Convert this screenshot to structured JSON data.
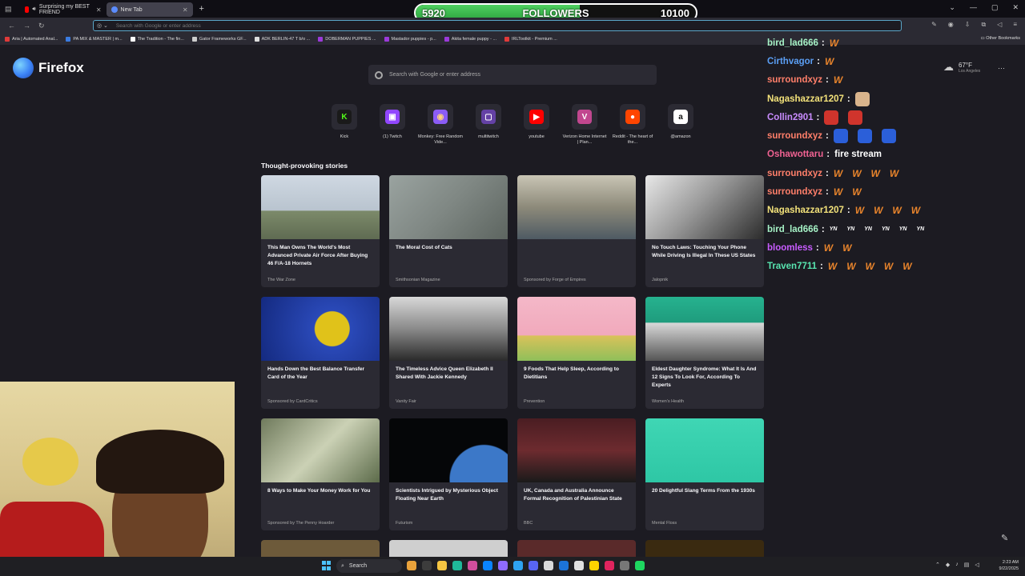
{
  "tabs": [
    {
      "label": "Surprising my BEST FRIEND",
      "active": false
    },
    {
      "label": "New Tab",
      "active": true
    }
  ],
  "followers_goal": {
    "current": "5920",
    "label": "FOLLOWERS",
    "target": "10100",
    "progress": 0.586
  },
  "urlbar": {
    "placeholder": "Search with Google or enter address"
  },
  "bookmarks": [
    "Aria | Automated Anal...",
    "PA MIX & MASTER | m...",
    "The Tradition - The fin...",
    "Gator Frameworks GF...",
    "ADK BERLIN-47 T b/o ...",
    "DOBERMAN PUPPIES ...",
    "Mastador puppies - p...",
    "Akita female puppy - ...",
    "IRLToolkit - Premium ..."
  ],
  "other_bookmarks": "Other Bookmarks",
  "brand": {
    "name": "Firefox"
  },
  "search": {
    "placeholder": "Search with Google or enter address"
  },
  "weather": {
    "temp": "67°F",
    "city": "Los Angeles"
  },
  "shortcuts": [
    {
      "label": "Kick",
      "icon": "kick-icon",
      "bg": "#1a1a1a",
      "fg": "#53fc18",
      "glyph": "K"
    },
    {
      "label": "(1) Twitch",
      "icon": "twitch-icon",
      "bg": "#9146ff",
      "fg": "#ffffff",
      "glyph": "▣"
    },
    {
      "label": "Monkey: Free Random Vide...",
      "icon": "monkey-icon",
      "bg": "#8b5cf6",
      "fg": "#ffd27a",
      "glyph": "◉"
    },
    {
      "label": "multitwitch",
      "icon": "multitwitch-icon",
      "bg": "#6441a5",
      "fg": "#ffffff",
      "glyph": "▢"
    },
    {
      "label": "youtube",
      "icon": "youtube-icon",
      "bg": "#ff0000",
      "fg": "#ffffff",
      "glyph": "▶"
    },
    {
      "label": "Verizon Home Internet | Plan...",
      "icon": "verizon-icon",
      "bg": "#c1478f",
      "fg": "#ffffff",
      "glyph": "V"
    },
    {
      "label": "Reddit - The heart of the...",
      "icon": "reddit-icon",
      "bg": "#ff4500",
      "fg": "#ffffff",
      "glyph": "●"
    },
    {
      "label": "@amazon",
      "icon": "amazon-icon",
      "bg": "#ffffff",
      "fg": "#111111",
      "glyph": "a"
    }
  ],
  "stories_title": "Thought-provoking stories",
  "stories": [
    {
      "title": "This Man Owns The World's Most Advanced Private Air Force After Buying 46 F/A-18 Hornets",
      "source": "The War Zone",
      "img": "linear-gradient(180deg,#cfd8e2 0%,#b9c4cf 55%,#7c8a6a 56%,#5f6b52 100%)"
    },
    {
      "title": "The Moral Cost of Cats",
      "source": "Smithsonian Magazine",
      "img": "linear-gradient(135deg,#9aa3a0 0%,#7f8783 50%,#5d6560 100%)"
    },
    {
      "title": "",
      "source": "Sponsored by Forge of Empires",
      "img": "linear-gradient(180deg,#c9c5b5 0%,#8d8a7a 50%,#4e5a63 100%)"
    },
    {
      "title": "No Touch Laws: Touching Your Phone While Driving Is Illegal In These US States",
      "source": "Jalopnik",
      "img": "linear-gradient(135deg,#e8e8e8 0%,#9a9a9a 45%,#2b2b2b 100%)"
    },
    {
      "title": "Hands Down the Best Balance Transfer Card of the Year",
      "source": "Sponsored by CardCritics",
      "img": "radial-gradient(circle at 60% 50%,#e0c21a 0 22%,#2a49b8 23%,#142a80 100%)"
    },
    {
      "title": "The Timeless Advice Queen Elizabeth II Shared With Jackie Kennedy",
      "source": "Vanity Fair",
      "img": "linear-gradient(180deg,#d8d8d8 0%,#8a8a8a 50%,#2a2a2a 100%)"
    },
    {
      "title": "9 Foods That Help Sleep, According to Dietitians",
      "source": "Prevention",
      "img": "linear-gradient(180deg,#f4b8c8 0%,#f1a9bc 60%,#d9c25a 61%,#8fbf5a 100%)"
    },
    {
      "title": "Eldest Daughter Syndrome: What It Is And 12 Signs To Look For, According To Experts",
      "source": "Women's Health",
      "img": "linear-gradient(180deg,#26b28f 0%,#1f9c7d 40%,#d8d8d8 41%,#555 100%)"
    },
    {
      "title": "8 Ways to Make Your Money Work for You",
      "source": "Sponsored by The Penny Hoarder",
      "img": "linear-gradient(135deg,#6f7a5c 0%,#cbd1b5 50%,#5c6b4a 100%)"
    },
    {
      "title": "Scientists Intrigued by Mysterious Object Floating Near Earth",
      "source": "Futurism",
      "img": "radial-gradient(circle at 80% 95%,#3c78c8 0 30%,#050608 31%,#050608 100%)"
    },
    {
      "title": "UK, Canada and Australia Announce Formal Recognition of Palestinian State",
      "source": "BBC",
      "img": "linear-gradient(180deg,#4a1d22 0%,#6d2b2f 50%,#1a1a1a 100%)"
    },
    {
      "title": "20 Delightful Slang Terms From the 1930s",
      "source": "Mental Floss",
      "img": "linear-gradient(180deg,#3fd6b4 0%,#2ec7a5 100%)"
    }
  ],
  "partial_rows": [
    "#6d5a3a",
    "#cfcfcf",
    "#5a2a2a",
    "#3a2a10"
  ],
  "chat": [
    {
      "user": "bird_lad666",
      "color": "#a6f2c6",
      "text": "",
      "emotes": [
        "W"
      ]
    },
    {
      "user": "Cirthvagor",
      "color": "#5b9ff5",
      "text": "",
      "emotes": [
        "W"
      ]
    },
    {
      "user": "surroundxyz",
      "color": "#ff7f6a",
      "text": "",
      "emotes": [
        "W"
      ]
    },
    {
      "user": "Nagashazzar1207",
      "color": "#f3e27a",
      "text": "",
      "emotes": [
        "face"
      ]
    },
    {
      "user": "Collin2901",
      "color": "#c98cff",
      "text": "",
      "emotes": [
        "redface",
        "redface"
      ]
    },
    {
      "user": "surroundxyz",
      "color": "#ff7f6a",
      "text": "",
      "emotes": [
        "blueface",
        "blueface",
        "blueface"
      ]
    },
    {
      "user": "Oshawottaru",
      "color": "#f06292",
      "text": "fire stream",
      "emotes": []
    },
    {
      "user": "surroundxyz",
      "color": "#ff7f6a",
      "text": "",
      "emotes": [
        "W",
        "W",
        "W",
        "W"
      ]
    },
    {
      "user": "surroundxyz",
      "color": "#ff7f6a",
      "text": "",
      "emotes": [
        "W",
        "W"
      ]
    },
    {
      "user": "Nagashazzar1207",
      "color": "#f3e27a",
      "text": "",
      "emotes": [
        "W",
        "W",
        "W",
        "W"
      ]
    },
    {
      "user": "bird_lad666",
      "color": "#a6f2c6",
      "text": "",
      "emotes": [
        "YN",
        "YN",
        "YN",
        "YN",
        "YN",
        "YN"
      ]
    },
    {
      "user": "bloomless",
      "color": "#c85cff",
      "text": "",
      "emotes": [
        "W",
        "W"
      ]
    },
    {
      "user": "Traven7711",
      "color": "#58e5b0",
      "text": "",
      "emotes": [
        "W",
        "W",
        "W",
        "W",
        "W"
      ]
    }
  ],
  "taskbar": {
    "search_label": "Search",
    "time": "2:23 AM",
    "date": "9/22/2025",
    "apps": [
      "#e9a23b",
      "#3c3c3c",
      "#f5c542",
      "#1fb89a",
      "#d14e9c",
      "#0a84ff",
      "#8f6bff",
      "#2ea3f2",
      "#5865f2",
      "#d9d9d9",
      "#1c74d9",
      "#e0e0e0",
      "#ffd400",
      "#e0245e",
      "#777777",
      "#1ed760"
    ]
  }
}
